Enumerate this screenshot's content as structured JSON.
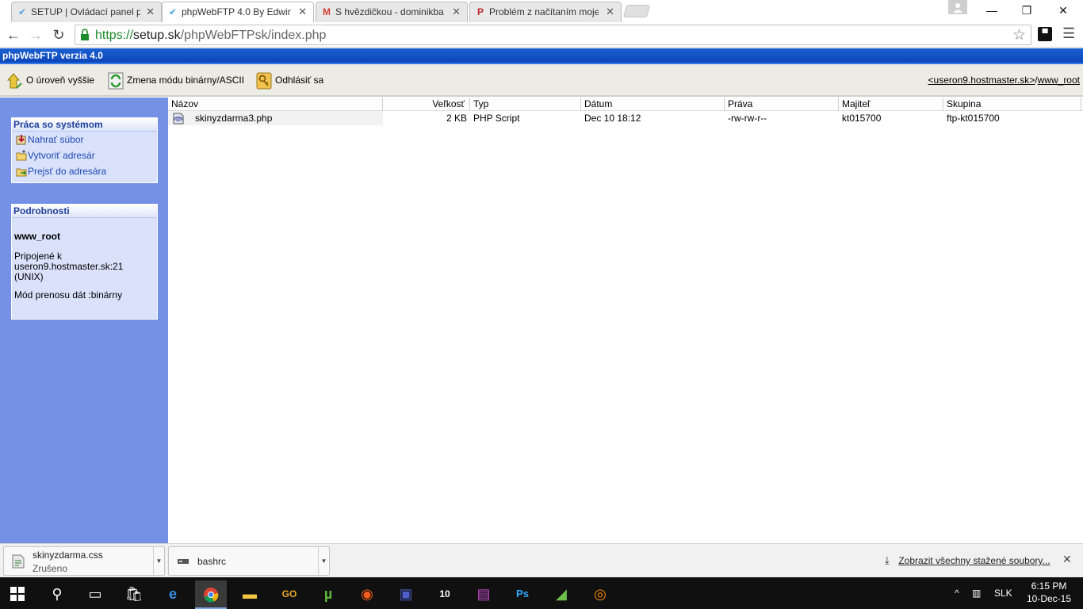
{
  "browser": {
    "tabs": [
      {
        "label": "SETUP | Ovládací panel pre",
        "active": false
      },
      {
        "label": "phpWebFTP 4.0 By Edwin",
        "active": true
      },
      {
        "label": "S hvězdičkou - dominikba",
        "active": false
      },
      {
        "label": "Problém z načítaním moje",
        "active": false
      }
    ],
    "url": {
      "scheme": "https://",
      "host": "setup.sk",
      "path": "/phpWebFTPsk/index.php"
    },
    "window_controls": {
      "minimize": "—",
      "restore": "❐",
      "close": "✕"
    }
  },
  "app": {
    "title": "phpWebFTP verzia 4.0",
    "commands": {
      "up_level": "O úroveň vyššie",
      "toggle_mode": "Zmena módu binárny/ASCII",
      "logout": "Odhlásiť sa"
    },
    "breadcrumb": {
      "host": "<useron9.hostmaster.sk>",
      "separator": "/",
      "dir": "www_root"
    }
  },
  "sidebar": {
    "system_box": {
      "title": "Práca so systémom",
      "links": [
        "Nahrať súbor",
        "Vytvoriť adresár",
        "Prejsť do adresára"
      ]
    },
    "details_box": {
      "title": "Podrobnosti",
      "dirname": "www_root",
      "connected_label": "Pripojené k",
      "host": "useron9.hostmaster.sk:21",
      "os": "(UNIX)",
      "mode": "Mód prenosu dát :binárny"
    }
  },
  "file_table": {
    "columns": [
      "Názov",
      "Veľkosť",
      "Typ",
      "Dátum",
      "Práva",
      "Majiteľ",
      "Skupina"
    ],
    "rows": [
      {
        "name": "skinyzdarma3.php",
        "size": "2 KB",
        "type": "PHP Script",
        "date": "Dec 10 18:12",
        "perms": "-rw-rw-r--",
        "owner": "kt015700",
        "group": "ftp-kt015700"
      }
    ]
  },
  "downloads": {
    "items": [
      {
        "name": "skinyzdarma.css",
        "status": "Zrušeno"
      },
      {
        "name": "bashrc",
        "status": ""
      }
    ],
    "show_all": "Zobrazit všechny stažené soubory..."
  },
  "taskbar": {
    "lang": "SLK",
    "time": "6:15 PM",
    "date": "10-Dec-15"
  },
  "colors": {
    "app_title_bar": "#0b44b8",
    "sidebar_bg": "#7591e6",
    "link_blue": "#1d49b4",
    "secure_green": "#1b8a2b"
  }
}
